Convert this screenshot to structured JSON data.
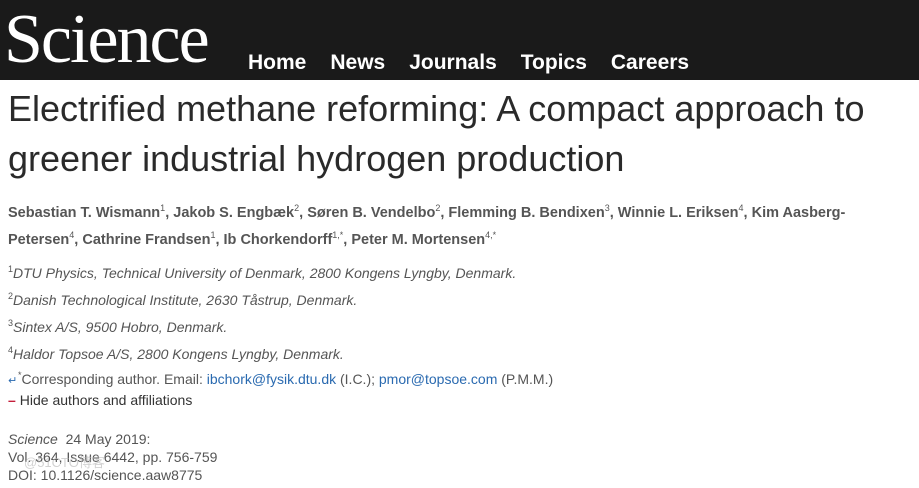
{
  "header": {
    "logo": "Science",
    "nav": [
      "Home",
      "News",
      "Journals",
      "Topics",
      "Careers"
    ]
  },
  "article": {
    "title": "Electrified methane reforming: A compact approach to greener industrial hydrogen production",
    "authors": [
      {
        "name": "Sebastian T. Wismann",
        "sup": "1"
      },
      {
        "name": "Jakob S. Engbæk",
        "sup": "2"
      },
      {
        "name": "Søren B. Vendelbo",
        "sup": "2"
      },
      {
        "name": "Flemming B. Bendixen",
        "sup": "3"
      },
      {
        "name": "Winnie L. Eriksen",
        "sup": "4"
      },
      {
        "name": "Kim Aasberg-Petersen",
        "sup": "4"
      },
      {
        "name": "Cathrine Frandsen",
        "sup": "1"
      },
      {
        "name": "Ib Chorkendorff",
        "sup": "1,*"
      },
      {
        "name": "Peter M. Mortensen",
        "sup": "4,*"
      }
    ],
    "affiliations": [
      {
        "sup": "1",
        "text": "DTU Physics, Technical University of Denmark, 2800 Kongens Lyngby, Denmark."
      },
      {
        "sup": "2",
        "text": "Danish Technological Institute, 2630 Tåstrup, Denmark."
      },
      {
        "sup": "3",
        "text": "Sintex A/S, 9500 Hobro, Denmark."
      },
      {
        "sup": "4",
        "text": "Haldor Topsoe A/S, 2800 Kongens Lyngby, Denmark."
      }
    ],
    "corresponding": {
      "prefix": "Corresponding author. Email: ",
      "email1": "ibchork@fysik.dtu.dk",
      "initials1": " (I.C.); ",
      "email2": "pmor@topsoe.com",
      "initials2": " (P.M.M.)"
    },
    "hide_label": "Hide authors and affiliations",
    "citation": {
      "journal": "Science",
      "date": "24 May 2019:",
      "volume": "Vol. 364, Issue 6442, pp. 756-759",
      "doi": "DOI: 10.1126/science.aaw8775"
    }
  },
  "watermark": "@51CTO博客"
}
